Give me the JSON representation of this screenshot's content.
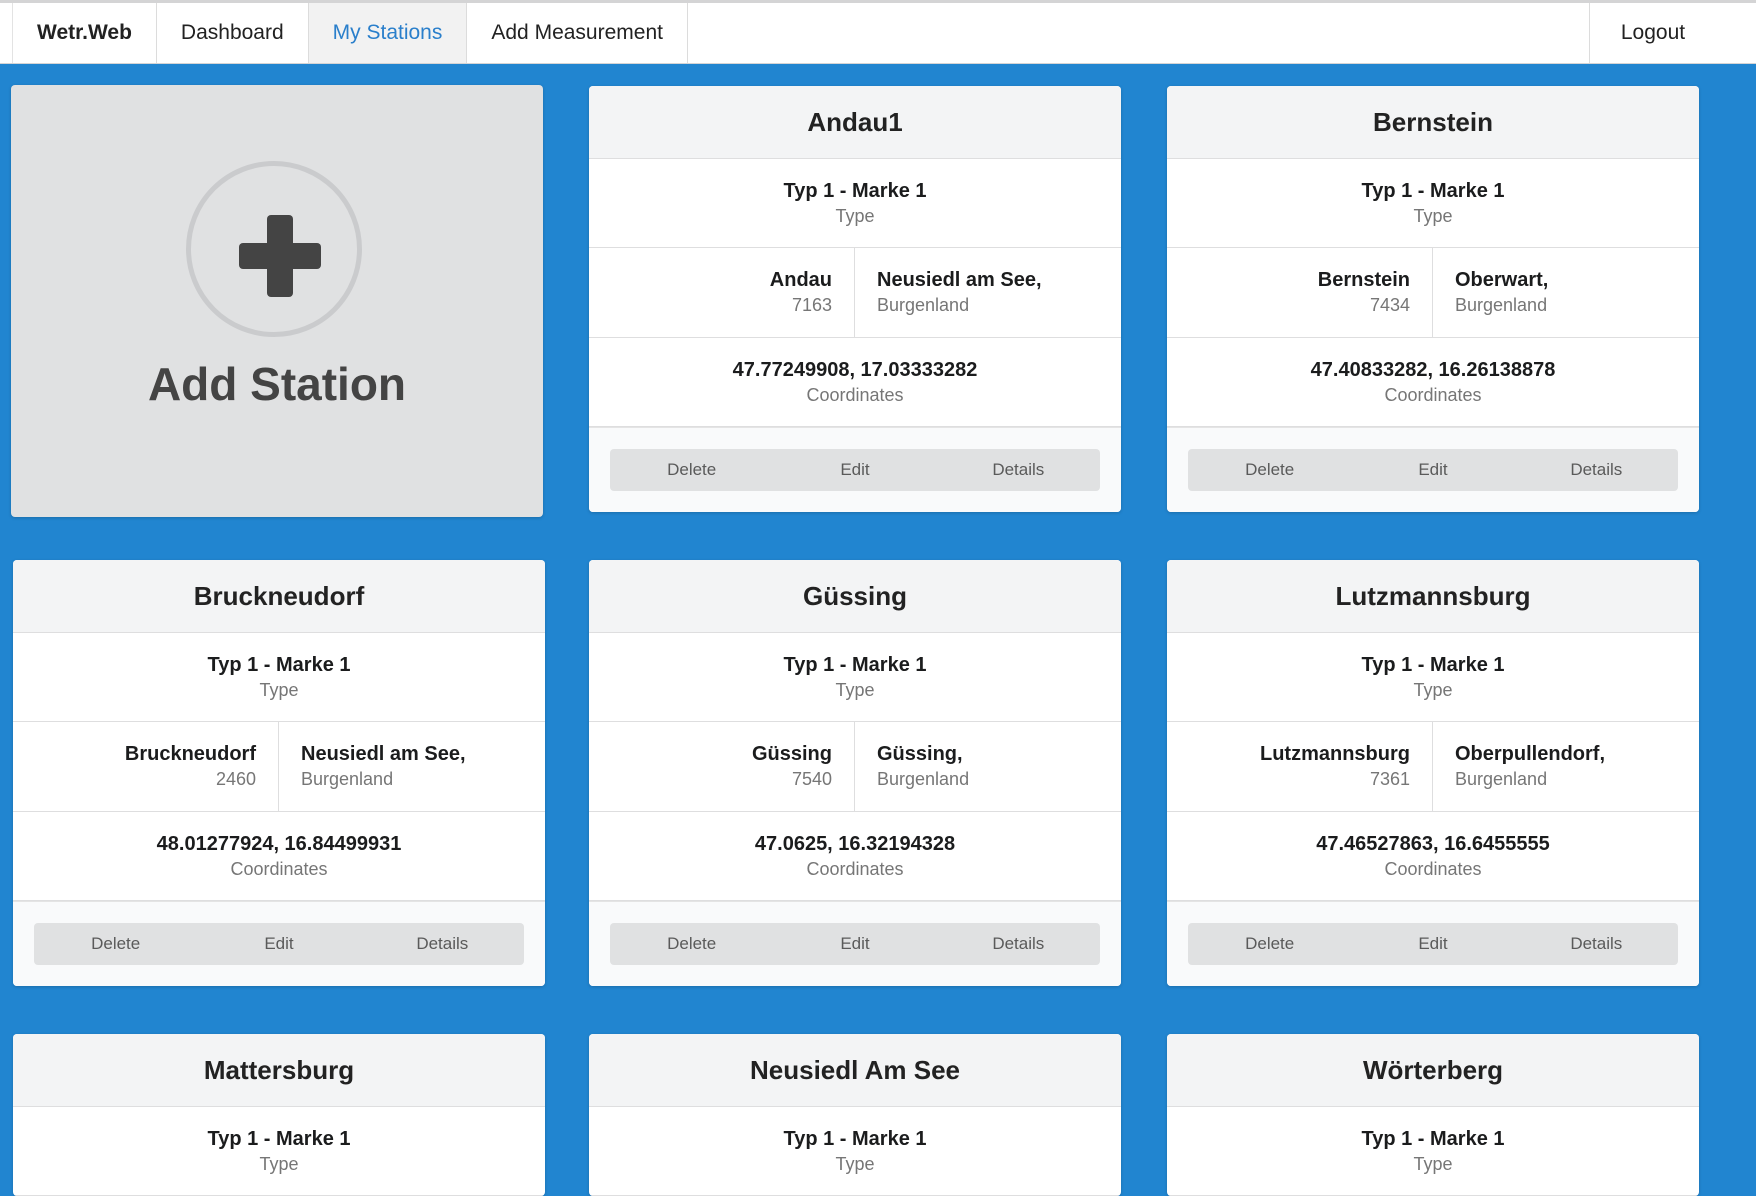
{
  "nav": {
    "brand": "Wetr.Web",
    "items": [
      "Dashboard",
      "My Stations",
      "Add Measurement"
    ],
    "active": "My Stations",
    "logout": "Logout"
  },
  "add_card": {
    "label": "Add Station",
    "icon": "plus-circle-icon"
  },
  "labels": {
    "type": "Type",
    "coordinates": "Coordinates",
    "delete": "Delete",
    "edit": "Edit",
    "details": "Details"
  },
  "colors": {
    "background": "#2185d0",
    "active_link": "#2a7fcb"
  },
  "stations": [
    {
      "name": "Andau1",
      "type": "Typ 1 - Marke 1",
      "town": "Andau",
      "zip": "7163",
      "district": "Neusiedl am See,",
      "state": "Burgenland",
      "coords": "47.77249908, 17.03333282"
    },
    {
      "name": "Bernstein",
      "type": "Typ 1 - Marke 1",
      "town": "Bernstein",
      "zip": "7434",
      "district": "Oberwart,",
      "state": "Burgenland",
      "coords": "47.40833282, 16.26138878"
    },
    {
      "name": "Bruckneudorf",
      "type": "Typ 1 - Marke 1",
      "town": "Bruckneudorf",
      "zip": "2460",
      "district": "Neusiedl am See,",
      "state": "Burgenland",
      "coords": "48.01277924, 16.84499931"
    },
    {
      "name": "Güssing",
      "type": "Typ 1 - Marke 1",
      "town": "Güssing",
      "zip": "7540",
      "district": "Güssing,",
      "state": "Burgenland",
      "coords": "47.0625, 16.32194328"
    },
    {
      "name": "Lutzmannsburg",
      "type": "Typ 1 - Marke 1",
      "town": "Lutzmannsburg",
      "zip": "7361",
      "district": "Oberpullendorf,",
      "state": "Burgenland",
      "coords": "47.46527863, 16.6455555"
    },
    {
      "name": "Mattersburg",
      "type": "Typ 1 - Marke 1"
    },
    {
      "name": "Neusiedl Am See",
      "type": "Typ 1 - Marke 1"
    },
    {
      "name": "Wörterberg",
      "type": "Typ 1 - Marke 1"
    }
  ]
}
